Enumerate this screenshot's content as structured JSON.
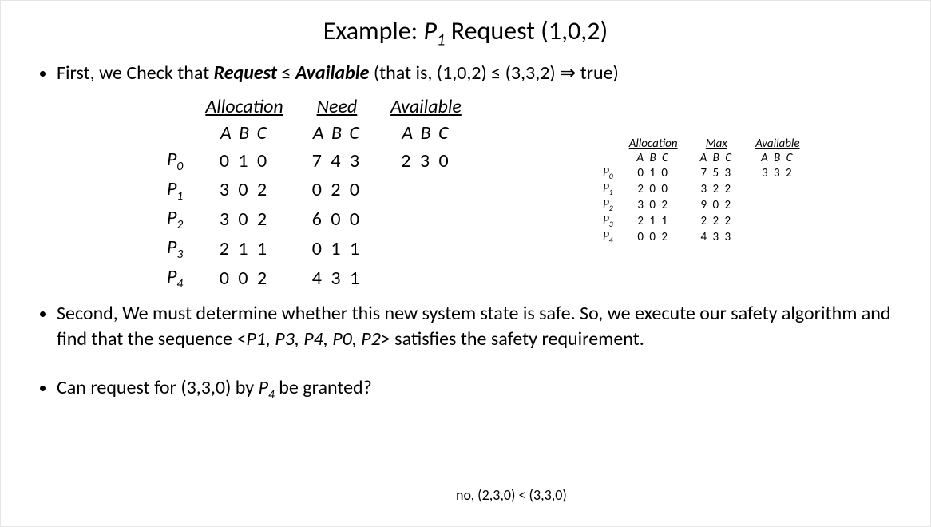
{
  "title": {
    "prefix": "Example:  ",
    "proc_label": "P",
    "proc_sub": "1",
    "suffix": " Request (1,0,2)"
  },
  "bullet1": {
    "lead": "First, we Check that ",
    "req": "Request",
    "leq": " ≤ ",
    "avail": "Available",
    "rest": " (that is, (1,0,2) ≤ (3,3,2) ⇒ true)"
  },
  "main": {
    "headers": {
      "alloc": "Allocation",
      "need": "Need",
      "avail": "Available"
    },
    "abc": "A B C",
    "rows": [
      {
        "proc": "P",
        "sub": "0",
        "alloc": "0 1 0",
        "need": "7 4 3",
        "avail": "2 3 0"
      },
      {
        "proc": "P",
        "sub": "1",
        "alloc": "3 0 2",
        "need": "0 2 0",
        "avail": ""
      },
      {
        "proc": "P",
        "sub": "2",
        "alloc": "3 0 2",
        "need": "6 0 0",
        "avail": ""
      },
      {
        "proc": "P",
        "sub": "3",
        "alloc": "2 1 1",
        "need": "0 1 1",
        "avail": ""
      },
      {
        "proc": "P",
        "sub": "4",
        "alloc": "0 0 2",
        "need": "4 3 1",
        "avail": ""
      }
    ]
  },
  "side": {
    "headers": {
      "alloc": "Allocation",
      "max": "Max",
      "avail": "Available"
    },
    "abc": "A B C",
    "rows": [
      {
        "proc": "P",
        "sub": "0",
        "alloc": "0 1 0",
        "max": "7 5 3",
        "avail": "3 3 2"
      },
      {
        "proc": "P",
        "sub": "1",
        "alloc": "2 0 0",
        "max": "3 2 2",
        "avail": ""
      },
      {
        "proc": "P",
        "sub": "2",
        "alloc": "3 0 2",
        "max": "9 0 2",
        "avail": ""
      },
      {
        "proc": "P",
        "sub": "3",
        "alloc": "2 1 1",
        "max": "2 2 2",
        "avail": ""
      },
      {
        "proc": "P",
        "sub": "4",
        "alloc": "0 0 2",
        "max": "4 3 3",
        "avail": ""
      }
    ]
  },
  "bullet2": {
    "l1a": "Second, We must determine whether this new system state is safe. So, we execute our safety algorithm and find that the sequence <",
    "seq": "P1, P3, P4, P0, P2",
    "l1b": "> satisfies the safety requirement."
  },
  "bullet3": {
    "lead": "Can request for (3,3,0) by ",
    "proc": "P",
    "sub": "4",
    "tail": " be granted?"
  },
  "answer": "no, (2,3,0) < (3,3,0)"
}
